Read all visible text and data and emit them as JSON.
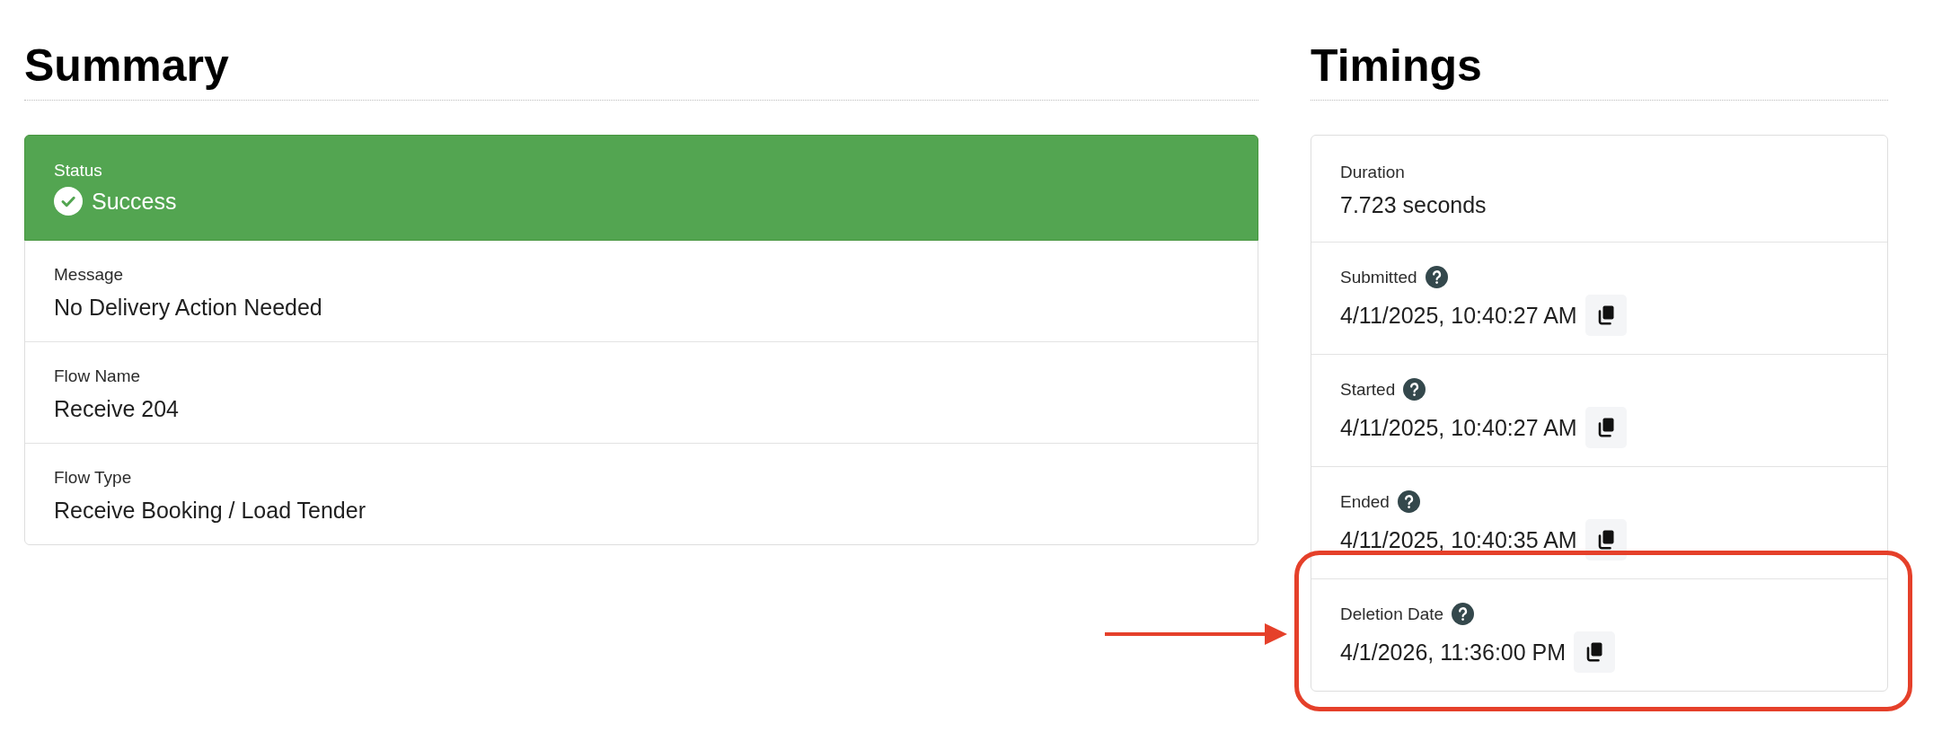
{
  "summary": {
    "title": "Summary",
    "status": {
      "label": "Status",
      "value": "Success",
      "success": true
    },
    "fields": [
      {
        "label": "Message",
        "value": "No Delivery Action Needed"
      },
      {
        "label": "Flow Name",
        "value": "Receive 204"
      },
      {
        "label": "Flow Type",
        "value": "Receive Booking / Load Tender"
      }
    ]
  },
  "timings": {
    "title": "Timings",
    "rows": [
      {
        "label": "Duration",
        "value": "7.723 seconds",
        "help": false,
        "copy_button": false,
        "highlighted": false
      },
      {
        "label": "Submitted",
        "value": "4/11/2025, 10:40:27 AM",
        "help": true,
        "copy_button": true,
        "highlighted": false
      },
      {
        "label": "Started",
        "value": "4/11/2025, 10:40:27 AM",
        "help": true,
        "copy_button": true,
        "highlighted": false
      },
      {
        "label": "Ended",
        "value": "4/11/2025, 10:40:35 AM",
        "help": true,
        "copy_button": true,
        "highlighted": false
      },
      {
        "label": "Deletion Date",
        "value": "4/1/2026, 11:36:00 PM",
        "help": true,
        "copy_button": true,
        "highlighted": true
      }
    ]
  }
}
